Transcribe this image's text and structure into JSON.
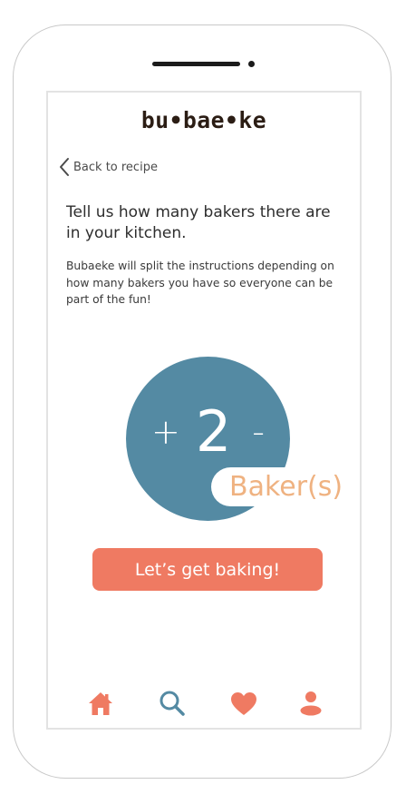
{
  "app": {
    "logo_text": "bu•bae•ke"
  },
  "nav_back": {
    "label": "Back to recipe",
    "icon": "chevron-left-icon"
  },
  "content": {
    "headline": "Tell us how many bakers there are in your kitchen.",
    "description": "Bubaeke will split the instructions depending on how many bakers you have so everyone can be part of the fun!"
  },
  "baker_counter": {
    "increment_label": "+",
    "count": "2",
    "decrement_label": "-",
    "unit_label": "Baker(s)"
  },
  "cta": {
    "label": "Let’s get baking!"
  },
  "bottom_nav": {
    "items": [
      {
        "icon": "home-icon",
        "color": "#ef7a62"
      },
      {
        "icon": "search-icon",
        "color": "#548aa3"
      },
      {
        "icon": "heart-icon",
        "color": "#ef7a62"
      },
      {
        "icon": "user-icon",
        "color": "#ef7a62"
      }
    ]
  },
  "colors": {
    "primary_blue": "#548aa3",
    "accent_coral": "#ef7a62",
    "accent_peach": "#efb281",
    "logo_dark": "#2b1d14"
  }
}
